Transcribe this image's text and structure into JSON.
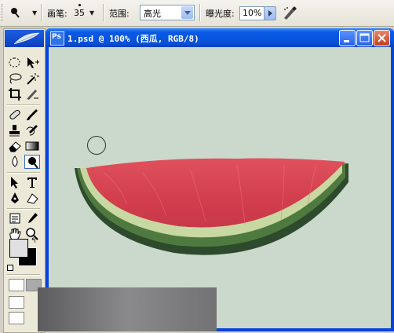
{
  "options_bar": {
    "brush_label": "画笔:",
    "brush_size": "35",
    "range_label": "范围:",
    "range_value": "高光",
    "exposure_label": "曝光度:",
    "exposure_value": "10%",
    "tool_icon": "dodge-tool-icon",
    "airbrush_icon": "airbrush-icon"
  },
  "document": {
    "title": "1.psd @ 100% (西瓜, RGB/8)",
    "canvas_color": "#cbd8cc"
  },
  "toolbox": {
    "tools": [
      "marquee-icon",
      "move-icon",
      "lasso-icon",
      "magic-wand-icon",
      "crop-icon",
      "slice-icon",
      "healing-brush-icon",
      "brush-icon",
      "clone-stamp-icon",
      "history-brush-icon",
      "eraser-icon",
      "gradient-icon",
      "blur-icon",
      "dodge-icon",
      "path-selection-icon",
      "type-icon",
      "pen-icon",
      "shape-icon",
      "notes-icon",
      "eyedropper-icon",
      "hand-icon",
      "zoom-icon"
    ],
    "foreground_color": "#e0e0e0",
    "background_color": "#000000"
  }
}
